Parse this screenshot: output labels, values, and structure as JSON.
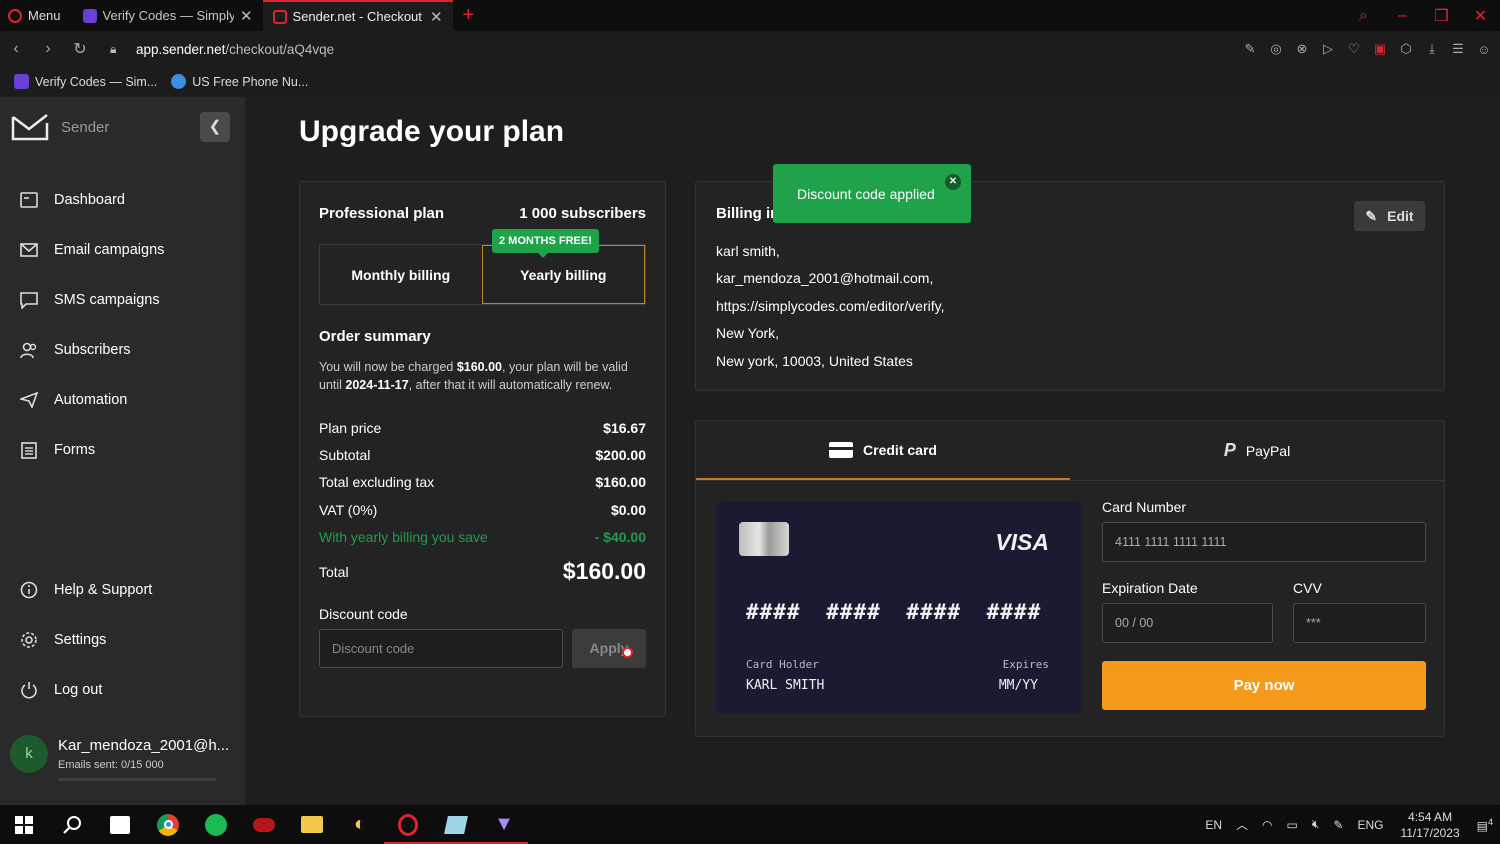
{
  "browser": {
    "menu_label": "Menu",
    "tabs": [
      {
        "title": "Verify Codes — SimplyCodes",
        "active": false
      },
      {
        "title": "Sender.net - Checkout",
        "active": true
      }
    ],
    "url_host": "app.sender.net",
    "url_path": "/checkout/aQ4vqe",
    "bookmarks": [
      {
        "label": "Verify Codes — Sim..."
      },
      {
        "label": "US Free Phone Nu..."
      }
    ],
    "accent": "#e0242f"
  },
  "sidebar": {
    "logo_text": "Sender",
    "items": [
      {
        "label": "Dashboard",
        "icon": "dashboard-icon"
      },
      {
        "label": "Email campaigns",
        "icon": "mail-icon"
      },
      {
        "label": "SMS campaigns",
        "icon": "sms-icon"
      },
      {
        "label": "Subscribers",
        "icon": "users-icon"
      },
      {
        "label": "Automation",
        "icon": "paper-plane-icon"
      },
      {
        "label": "Forms",
        "icon": "list-icon"
      }
    ],
    "bottom_items": [
      {
        "label": "Help & Support",
        "icon": "info-icon"
      },
      {
        "label": "Settings",
        "icon": "gear-icon"
      },
      {
        "label": "Log out",
        "icon": "power-icon"
      }
    ],
    "user": {
      "avatar_letter": "k",
      "name": "Kar_mendoza_2001@h...",
      "emails_sent": "Emails sent: 0/15 000"
    }
  },
  "page": {
    "title": "Upgrade your plan"
  },
  "plan": {
    "name": "Professional plan",
    "subscribers": "1 000 subscribers",
    "promo_badge": "2 MONTHS FREE!",
    "monthly_label": "Monthly billing",
    "yearly_label": "Yearly billing",
    "selected": "yearly",
    "order_title": "Order summary",
    "desc_1": "You will now be charged ",
    "desc_amount": "$160.00",
    "desc_2": ", your plan will be valid until ",
    "desc_date": "2024-11-17",
    "desc_3": ", after that it will automatically renew.",
    "rows": [
      {
        "label": "Plan price",
        "value": "$16.67"
      },
      {
        "label": "Subtotal",
        "value": "$200.00"
      },
      {
        "label": "Total excluding tax",
        "value": "$160.00"
      },
      {
        "label": "VAT (0%)",
        "value": "$0.00"
      }
    ],
    "savings": {
      "label": "With yearly billing you save",
      "value": "- $40.00"
    },
    "total_label": "Total",
    "total_value": "$160.00",
    "discount_label": "Discount code",
    "discount_placeholder": "Discount code",
    "apply_label": "Apply"
  },
  "toast": {
    "text": "Discount code applied",
    "color": "#1fa24a"
  },
  "billing": {
    "title": "Billing information",
    "edit_label": "Edit",
    "lines": [
      "karl smith,",
      "kar_mendoza_2001@hotmail.com,",
      "https://simplycodes.com/editor/verify,",
      "New York,",
      "New york, 10003, United States"
    ]
  },
  "payment": {
    "tab_card": "Credit card",
    "tab_paypal": "PayPal",
    "card_visual": {
      "brand": "VISA",
      "number_mask": "#### #### #### ####",
      "holder_label": "Card Holder",
      "holder_name": "KARL SMITH",
      "expires_label": "Expires",
      "expires_value": "MM/YY"
    },
    "card_number_label": "Card Number",
    "card_number_placeholder": "4111 1111 1111 1111",
    "expiration_label": "Expiration Date",
    "expiration_placeholder": "00 / 00",
    "cvv_label": "CVV",
    "cvv_placeholder": "***",
    "pay_label": "Pay now",
    "pay_color": "#f59a1b"
  },
  "taskbar": {
    "lang_short": "EN",
    "lang_long": "ENG",
    "time": "4:54 AM",
    "date": "11/17/2023",
    "notifications": "4"
  }
}
